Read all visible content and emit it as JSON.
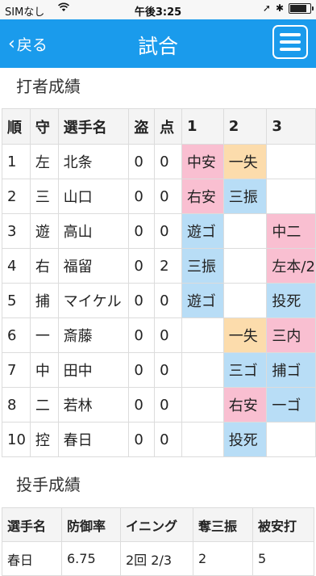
{
  "status": {
    "carrier": "SIMなし",
    "time": "午後3:25"
  },
  "nav": {
    "back_label": "戻る",
    "title": "試合"
  },
  "batting": {
    "title": "打者成績",
    "headers": [
      "順",
      "守",
      "選手名",
      "盗",
      "点",
      "1",
      "2",
      "3"
    ],
    "rows": [
      {
        "order": "1",
        "pos": "左",
        "name": "北条",
        "sb": "0",
        "rbi": "0",
        "i1": "中安",
        "i1c": "pink",
        "i2": "一失",
        "i2c": "orange",
        "i3": "",
        "i3c": ""
      },
      {
        "order": "2",
        "pos": "三",
        "name": "山口",
        "sb": "0",
        "rbi": "0",
        "i1": "右安",
        "i1c": "pink",
        "i2": "三振",
        "i2c": "blue",
        "i3": "",
        "i3c": ""
      },
      {
        "order": "3",
        "pos": "遊",
        "name": "高山",
        "sb": "0",
        "rbi": "0",
        "i1": "遊ゴ",
        "i1c": "blue",
        "i2": "",
        "i2c": "",
        "i3": "中二",
        "i3c": "pink"
      },
      {
        "order": "4",
        "pos": "右",
        "name": "福留",
        "sb": "0",
        "rbi": "2",
        "i1": "三振",
        "i1c": "blue",
        "i2": "",
        "i2c": "",
        "i3": "左本/2",
        "i3c": "pink"
      },
      {
        "order": "5",
        "pos": "捕",
        "name": "マイケル",
        "sb": "0",
        "rbi": "0",
        "i1": "遊ゴ",
        "i1c": "blue",
        "i2": "",
        "i2c": "",
        "i3": "投死",
        "i3c": "blue"
      },
      {
        "order": "6",
        "pos": "一",
        "name": "斎藤",
        "sb": "0",
        "rbi": "0",
        "i1": "",
        "i1c": "",
        "i2": "一失",
        "i2c": "orange",
        "i3": "三内",
        "i3c": "pink"
      },
      {
        "order": "7",
        "pos": "中",
        "name": "田中",
        "sb": "0",
        "rbi": "0",
        "i1": "",
        "i1c": "",
        "i2": "三ゴ",
        "i2c": "blue",
        "i3": "捕ゴ",
        "i3c": "blue"
      },
      {
        "order": "8",
        "pos": "二",
        "name": "若林",
        "sb": "0",
        "rbi": "0",
        "i1": "",
        "i1c": "",
        "i2": "右安",
        "i2c": "pink",
        "i3": "一ゴ",
        "i3c": "blue"
      },
      {
        "order": "10",
        "pos": "控",
        "name": "春日",
        "sb": "0",
        "rbi": "0",
        "i1": "",
        "i1c": "",
        "i2": "投死",
        "i2c": "blue",
        "i3": "",
        "i3c": ""
      }
    ]
  },
  "pitching": {
    "title": "投手成績",
    "headers": [
      "選手名",
      "防御率",
      "イニング",
      "奪三振",
      "被安打"
    ],
    "rows": [
      {
        "name": "春日",
        "era": "6.75",
        "innings": "2回 2/3",
        "so": "2",
        "hits": "5"
      }
    ]
  },
  "colors": {
    "nav_bg": "#1a9bec",
    "hit": "#f9bfd1",
    "out": "#b8ddf6",
    "error": "#fcdcac"
  }
}
